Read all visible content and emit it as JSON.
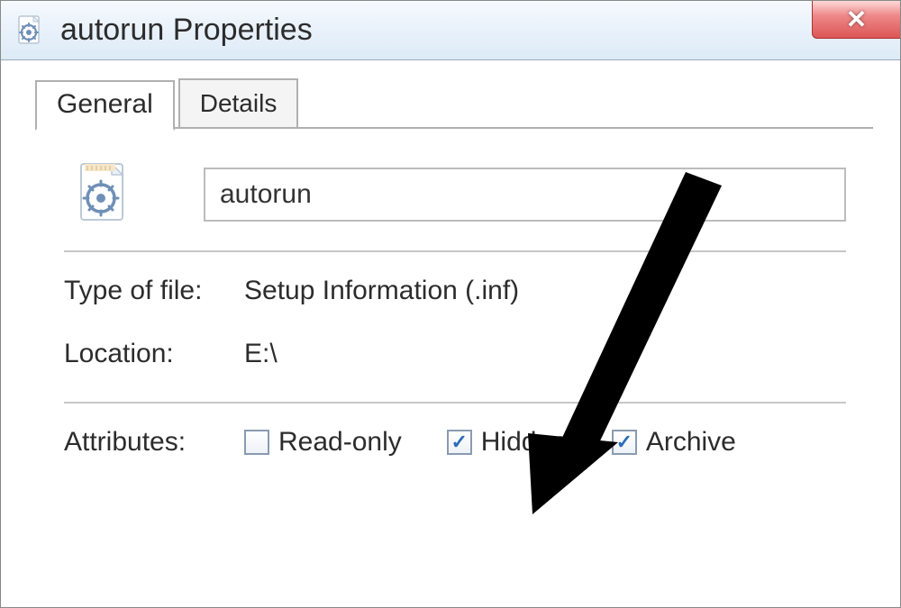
{
  "window": {
    "title": "autorun Properties"
  },
  "tabs": {
    "general": "General",
    "details": "Details"
  },
  "general": {
    "filename": "autorun",
    "type_label": "Type of file:",
    "type_value": "Setup Information (.inf)",
    "location_label": "Location:",
    "location_value": "E:\\",
    "attributes_label": "Attributes:",
    "attributes": {
      "readonly": {
        "label": "Read-only",
        "checked": false
      },
      "hidden": {
        "label": "Hidden",
        "checked": true
      },
      "archive": {
        "label": "Archive",
        "checked": true
      }
    }
  }
}
